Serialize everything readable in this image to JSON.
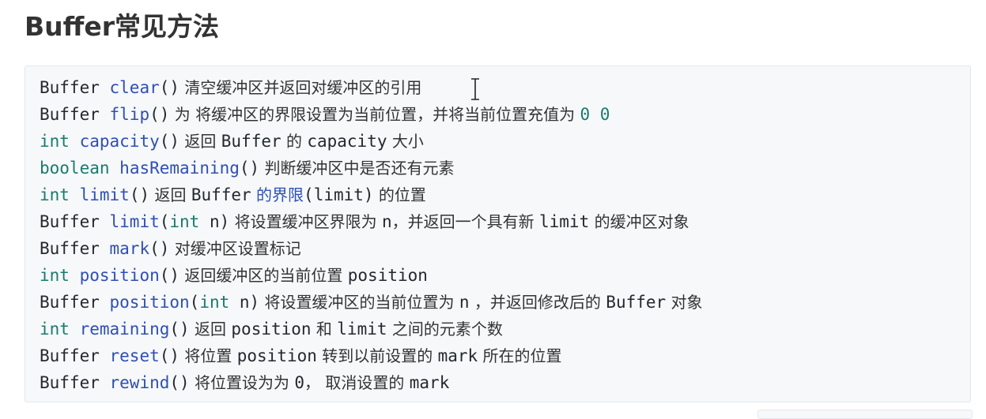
{
  "heading": "Buffer常见方法",
  "code_lines": [
    [
      {
        "t": "Buffer",
        "k": "type"
      },
      {
        "t": " ",
        "k": "punc"
      },
      {
        "t": "clear",
        "k": "method"
      },
      {
        "t": "()",
        "k": "punc"
      },
      {
        "t": " 清空缓冲区并返回对缓冲区的引用",
        "k": "text"
      }
    ],
    [
      {
        "t": "Buffer",
        "k": "type"
      },
      {
        "t": " ",
        "k": "punc"
      },
      {
        "t": "flip",
        "k": "method"
      },
      {
        "t": "()",
        "k": "punc"
      },
      {
        "t": " 为 将缓冲区的界限设置为当前位置，并将当前位置充值为 ",
        "k": "text"
      },
      {
        "t": "0 0",
        "k": "num"
      }
    ],
    [
      {
        "t": "int",
        "k": "kw"
      },
      {
        "t": " ",
        "k": "punc"
      },
      {
        "t": "capacity",
        "k": "method"
      },
      {
        "t": "()",
        "k": "punc"
      },
      {
        "t": " 返回 ",
        "k": "text"
      },
      {
        "t": "Buffer",
        "k": "mono"
      },
      {
        "t": " 的 ",
        "k": "text"
      },
      {
        "t": "capacity",
        "k": "mono"
      },
      {
        "t": " 大小",
        "k": "text"
      }
    ],
    [
      {
        "t": "boolean",
        "k": "kw"
      },
      {
        "t": " ",
        "k": "punc"
      },
      {
        "t": "hasRemaining",
        "k": "method"
      },
      {
        "t": "()",
        "k": "punc"
      },
      {
        "t": " 判断缓冲区中是否还有元素",
        "k": "text"
      }
    ],
    [
      {
        "t": "int",
        "k": "kw"
      },
      {
        "t": " ",
        "k": "punc"
      },
      {
        "t": "limit",
        "k": "method"
      },
      {
        "t": "()",
        "k": "punc"
      },
      {
        "t": " 返回 ",
        "k": "text"
      },
      {
        "t": "Buffer",
        "k": "mono"
      },
      {
        "t": " ",
        "k": "text"
      },
      {
        "t": "的界限",
        "k": "link"
      },
      {
        "t": "(limit)",
        "k": "mono"
      },
      {
        "t": " 的位置",
        "k": "text"
      }
    ],
    [
      {
        "t": "Buffer",
        "k": "type"
      },
      {
        "t": " ",
        "k": "punc"
      },
      {
        "t": "limit",
        "k": "method"
      },
      {
        "t": "(",
        "k": "punc"
      },
      {
        "t": "int",
        "k": "kw"
      },
      {
        "t": " n)",
        "k": "punc"
      },
      {
        "t": " 将设置缓冲区界限为 ",
        "k": "text"
      },
      {
        "t": "n",
        "k": "mono"
      },
      {
        "t": "，并返回一个具有新 ",
        "k": "text"
      },
      {
        "t": "limit",
        "k": "mono"
      },
      {
        "t": " 的缓冲区对象",
        "k": "text"
      }
    ],
    [
      {
        "t": "Buffer",
        "k": "type"
      },
      {
        "t": " ",
        "k": "punc"
      },
      {
        "t": "mark",
        "k": "method"
      },
      {
        "t": "()",
        "k": "punc"
      },
      {
        "t": " 对缓冲区设置标记",
        "k": "text"
      }
    ],
    [
      {
        "t": "int",
        "k": "kw"
      },
      {
        "t": " ",
        "k": "punc"
      },
      {
        "t": "position",
        "k": "method"
      },
      {
        "t": "()",
        "k": "punc"
      },
      {
        "t": " 返回缓冲区的当前位置 ",
        "k": "text"
      },
      {
        "t": "position",
        "k": "mono"
      }
    ],
    [
      {
        "t": "Buffer",
        "k": "type"
      },
      {
        "t": " ",
        "k": "punc"
      },
      {
        "t": "position",
        "k": "method"
      },
      {
        "t": "(",
        "k": "punc"
      },
      {
        "t": "int",
        "k": "kw"
      },
      {
        "t": " n)",
        "k": "punc"
      },
      {
        "t": " 将设置缓冲区的当前位置为 ",
        "k": "text"
      },
      {
        "t": "n",
        "k": "mono"
      },
      {
        "t": " ，并返回修改后的 ",
        "k": "text"
      },
      {
        "t": "Buffer",
        "k": "mono"
      },
      {
        "t": " 对象",
        "k": "text"
      }
    ],
    [
      {
        "t": "int",
        "k": "kw"
      },
      {
        "t": " ",
        "k": "punc"
      },
      {
        "t": "remaining",
        "k": "method"
      },
      {
        "t": "()",
        "k": "punc"
      },
      {
        "t": " 返回 ",
        "k": "text"
      },
      {
        "t": "position",
        "k": "mono"
      },
      {
        "t": " 和 ",
        "k": "text"
      },
      {
        "t": "limit",
        "k": "mono"
      },
      {
        "t": " 之间的元素个数",
        "k": "text"
      }
    ],
    [
      {
        "t": "Buffer",
        "k": "type"
      },
      {
        "t": " ",
        "k": "punc"
      },
      {
        "t": "reset",
        "k": "method"
      },
      {
        "t": "()",
        "k": "punc"
      },
      {
        "t": " 将位置 ",
        "k": "text"
      },
      {
        "t": "position",
        "k": "mono"
      },
      {
        "t": " 转到以前设置的 ",
        "k": "text"
      },
      {
        "t": "mark",
        "k": "mono"
      },
      {
        "t": " 所在的位置",
        "k": "text"
      }
    ],
    [
      {
        "t": "Buffer",
        "k": "type"
      },
      {
        "t": " ",
        "k": "punc"
      },
      {
        "t": "rewind",
        "k": "method"
      },
      {
        "t": "()",
        "k": "punc"
      },
      {
        "t": " 将位置设为为 ",
        "k": "text"
      },
      {
        "t": "0",
        "k": "mono"
      },
      {
        "t": "， 取消设置的 ",
        "k": "text"
      },
      {
        "t": "mark",
        "k": "mono"
      }
    ]
  ],
  "icons": {
    "cursor": "text-cursor-icon"
  }
}
